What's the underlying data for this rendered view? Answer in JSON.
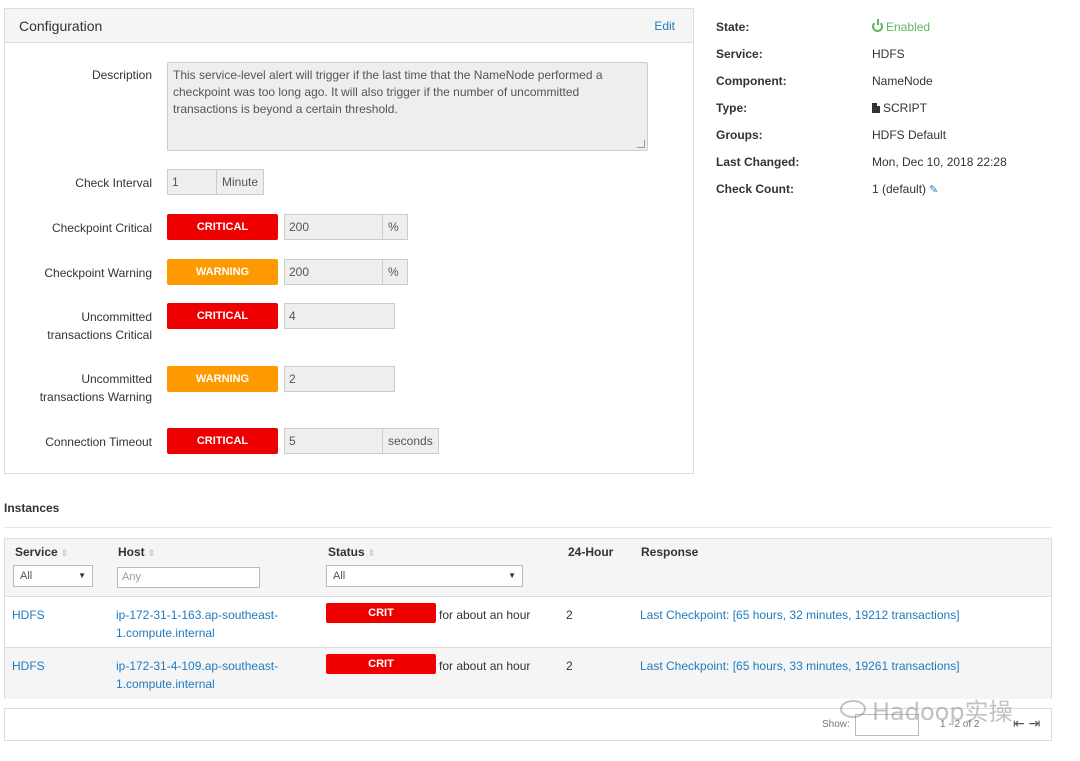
{
  "config": {
    "title": "Configuration",
    "edit_label": "Edit",
    "description_label": "Description",
    "description_text": "This service-level alert will trigger if the last time that the NameNode performed a checkpoint was too long ago. It will also trigger if the number of uncommitted transactions is beyond a certain threshold.",
    "fields": [
      {
        "label": "Check Interval",
        "value": "1",
        "unit": "Minute"
      },
      {
        "label": "Checkpoint Critical",
        "badge": "CRITICAL",
        "value": "200",
        "unit": "%"
      },
      {
        "label": "Checkpoint Warning",
        "badge": "WARNING",
        "value": "200",
        "unit": "%"
      },
      {
        "label_line1": "Uncommitted",
        "label_line2": "transactions Critical",
        "badge": "CRITICAL",
        "value": "4"
      },
      {
        "label_line1": "Uncommitted",
        "label_line2": "transactions Warning",
        "badge": "WARNING",
        "value": "2"
      },
      {
        "label": "Connection Timeout",
        "badge": "CRITICAL",
        "value": "5",
        "unit": "seconds"
      }
    ]
  },
  "info": {
    "state_key": "State:",
    "state_val": "Enabled",
    "service_key": "Service:",
    "service_val": "HDFS",
    "component_key": "Component:",
    "component_val": "NameNode",
    "type_key": "Type:",
    "type_val": "SCRIPT",
    "groups_key": "Groups:",
    "groups_val": "HDFS Default",
    "changed_key": "Last Changed:",
    "changed_val": "Mon, Dec 10, 2018 22:28",
    "count_key": "Check Count:",
    "count_val": "1 (default)"
  },
  "instances": {
    "title": "Instances",
    "headers": {
      "service": "Service",
      "host": "Host",
      "status": "Status",
      "hour": "24-Hour",
      "response": "Response"
    },
    "filters": {
      "service": "All",
      "host_placeholder": "Any",
      "status": "All"
    },
    "rows": [
      {
        "service": "HDFS",
        "host1": "ip-172-31-1-163.ap-southeast-",
        "host2": "1.compute.internal",
        "status": "CRIT",
        "duration": "for about an hour",
        "count": "2",
        "response": "Last Checkpoint: [65 hours, 32 minutes, 19212 transactions]"
      },
      {
        "service": "HDFS",
        "host1": "ip-172-31-4-109.ap-southeast-",
        "host2": "1.compute.internal",
        "status": "CRIT",
        "duration": "for about an hour",
        "count": "2",
        "response": "Last Checkpoint: [65 hours, 33 minutes, 19261 transactions]"
      }
    ],
    "footer": {
      "show_label": "Show:",
      "range": "1 - 2 of 2"
    }
  },
  "watermark": "Hadoop实操",
  "colors": {
    "critical": "#ee0000",
    "warning": "#ff9900",
    "link": "#1e7bbf",
    "enabled": "#5cb85c"
  }
}
